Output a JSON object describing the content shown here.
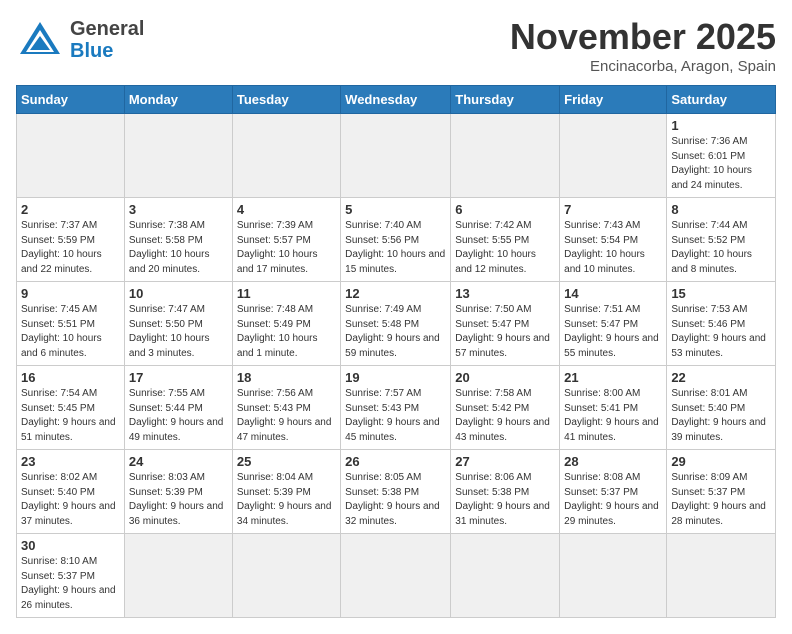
{
  "header": {
    "logo_general": "General",
    "logo_blue": "Blue",
    "month": "November 2025",
    "location": "Encinacorba, Aragon, Spain"
  },
  "weekdays": [
    "Sunday",
    "Monday",
    "Tuesday",
    "Wednesday",
    "Thursday",
    "Friday",
    "Saturday"
  ],
  "days": [
    {
      "date": "",
      "info": ""
    },
    {
      "date": "",
      "info": ""
    },
    {
      "date": "",
      "info": ""
    },
    {
      "date": "",
      "info": ""
    },
    {
      "date": "",
      "info": ""
    },
    {
      "date": "",
      "info": ""
    },
    {
      "date": "1",
      "info": "Sunrise: 7:36 AM\nSunset: 6:01 PM\nDaylight: 10 hours and 24 minutes."
    },
    {
      "date": "2",
      "info": "Sunrise: 7:37 AM\nSunset: 5:59 PM\nDaylight: 10 hours and 22 minutes."
    },
    {
      "date": "3",
      "info": "Sunrise: 7:38 AM\nSunset: 5:58 PM\nDaylight: 10 hours and 20 minutes."
    },
    {
      "date": "4",
      "info": "Sunrise: 7:39 AM\nSunset: 5:57 PM\nDaylight: 10 hours and 17 minutes."
    },
    {
      "date": "5",
      "info": "Sunrise: 7:40 AM\nSunset: 5:56 PM\nDaylight: 10 hours and 15 minutes."
    },
    {
      "date": "6",
      "info": "Sunrise: 7:42 AM\nSunset: 5:55 PM\nDaylight: 10 hours and 12 minutes."
    },
    {
      "date": "7",
      "info": "Sunrise: 7:43 AM\nSunset: 5:54 PM\nDaylight: 10 hours and 10 minutes."
    },
    {
      "date": "8",
      "info": "Sunrise: 7:44 AM\nSunset: 5:52 PM\nDaylight: 10 hours and 8 minutes."
    },
    {
      "date": "9",
      "info": "Sunrise: 7:45 AM\nSunset: 5:51 PM\nDaylight: 10 hours and 6 minutes."
    },
    {
      "date": "10",
      "info": "Sunrise: 7:47 AM\nSunset: 5:50 PM\nDaylight: 10 hours and 3 minutes."
    },
    {
      "date": "11",
      "info": "Sunrise: 7:48 AM\nSunset: 5:49 PM\nDaylight: 10 hours and 1 minute."
    },
    {
      "date": "12",
      "info": "Sunrise: 7:49 AM\nSunset: 5:48 PM\nDaylight: 9 hours and 59 minutes."
    },
    {
      "date": "13",
      "info": "Sunrise: 7:50 AM\nSunset: 5:47 PM\nDaylight: 9 hours and 57 minutes."
    },
    {
      "date": "14",
      "info": "Sunrise: 7:51 AM\nSunset: 5:47 PM\nDaylight: 9 hours and 55 minutes."
    },
    {
      "date": "15",
      "info": "Sunrise: 7:53 AM\nSunset: 5:46 PM\nDaylight: 9 hours and 53 minutes."
    },
    {
      "date": "16",
      "info": "Sunrise: 7:54 AM\nSunset: 5:45 PM\nDaylight: 9 hours and 51 minutes."
    },
    {
      "date": "17",
      "info": "Sunrise: 7:55 AM\nSunset: 5:44 PM\nDaylight: 9 hours and 49 minutes."
    },
    {
      "date": "18",
      "info": "Sunrise: 7:56 AM\nSunset: 5:43 PM\nDaylight: 9 hours and 47 minutes."
    },
    {
      "date": "19",
      "info": "Sunrise: 7:57 AM\nSunset: 5:43 PM\nDaylight: 9 hours and 45 minutes."
    },
    {
      "date": "20",
      "info": "Sunrise: 7:58 AM\nSunset: 5:42 PM\nDaylight: 9 hours and 43 minutes."
    },
    {
      "date": "21",
      "info": "Sunrise: 8:00 AM\nSunset: 5:41 PM\nDaylight: 9 hours and 41 minutes."
    },
    {
      "date": "22",
      "info": "Sunrise: 8:01 AM\nSunset: 5:40 PM\nDaylight: 9 hours and 39 minutes."
    },
    {
      "date": "23",
      "info": "Sunrise: 8:02 AM\nSunset: 5:40 PM\nDaylight: 9 hours and 37 minutes."
    },
    {
      "date": "24",
      "info": "Sunrise: 8:03 AM\nSunset: 5:39 PM\nDaylight: 9 hours and 36 minutes."
    },
    {
      "date": "25",
      "info": "Sunrise: 8:04 AM\nSunset: 5:39 PM\nDaylight: 9 hours and 34 minutes."
    },
    {
      "date": "26",
      "info": "Sunrise: 8:05 AM\nSunset: 5:38 PM\nDaylight: 9 hours and 32 minutes."
    },
    {
      "date": "27",
      "info": "Sunrise: 8:06 AM\nSunset: 5:38 PM\nDaylight: 9 hours and 31 minutes."
    },
    {
      "date": "28",
      "info": "Sunrise: 8:08 AM\nSunset: 5:37 PM\nDaylight: 9 hours and 29 minutes."
    },
    {
      "date": "29",
      "info": "Sunrise: 8:09 AM\nSunset: 5:37 PM\nDaylight: 9 hours and 28 minutes."
    },
    {
      "date": "30",
      "info": "Sunrise: 8:10 AM\nSunset: 5:37 PM\nDaylight: 9 hours and 26 minutes."
    }
  ]
}
